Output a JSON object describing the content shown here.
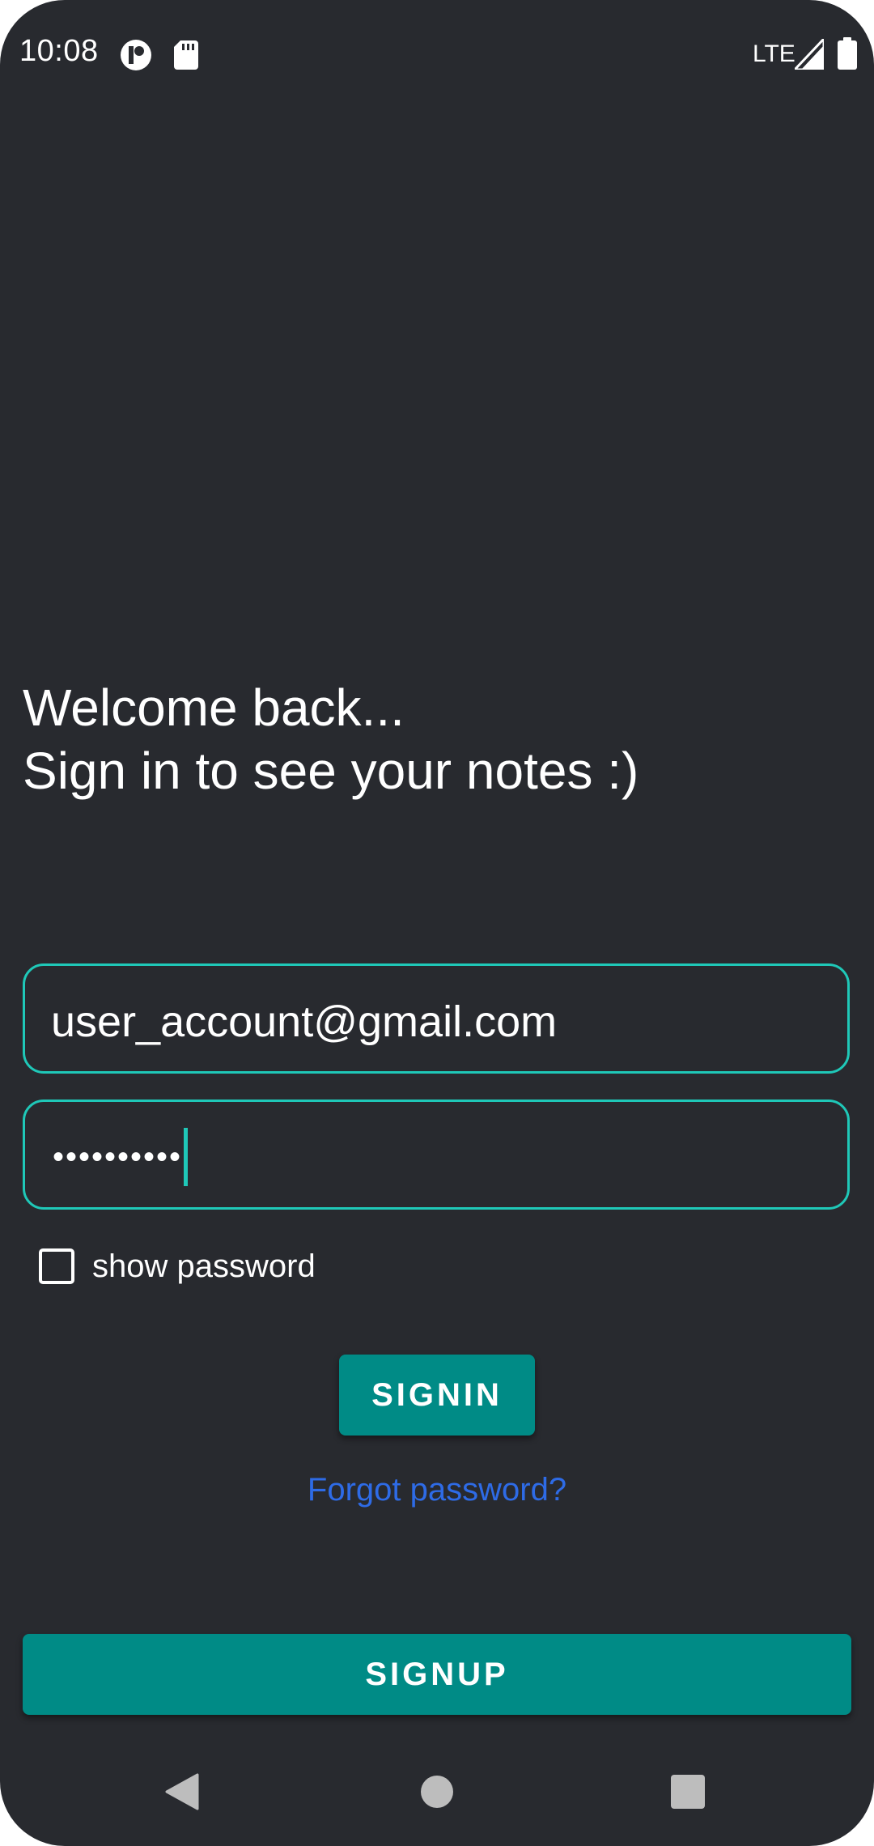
{
  "status_bar": {
    "time": "10:08",
    "network": "LTE",
    "icons": [
      "app-notification-icon",
      "sd-card-icon",
      "signal-icon",
      "battery-icon"
    ]
  },
  "welcome": {
    "line1": "Welcome back...",
    "line2": "Sign in to see your notes :)"
  },
  "form": {
    "email_value": "user_account@gmail.com",
    "password_masked": "••••••••••",
    "show_password_label": "show password",
    "show_password_checked": false
  },
  "buttons": {
    "signin_label": "SIGNIN",
    "forgot_label": "Forgot password?",
    "signup_label": "SIGNUP"
  },
  "nav": {
    "icons": [
      "back-icon",
      "home-icon",
      "recents-icon"
    ]
  },
  "colors": {
    "background": "#282a2f",
    "accent": "#1fc8b8",
    "button": "#008b86",
    "link": "#2e6be6"
  }
}
